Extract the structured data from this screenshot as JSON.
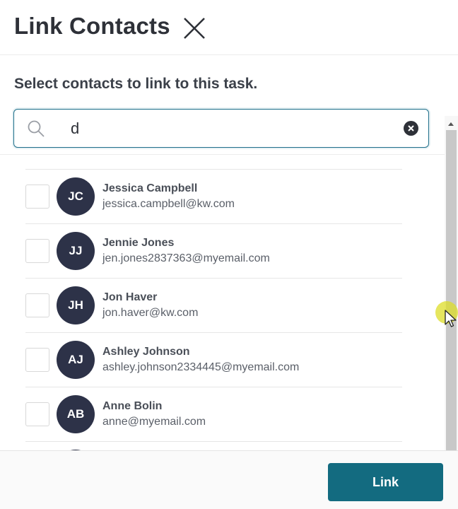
{
  "dialog": {
    "title": "Link Contacts",
    "instruction": "Select contacts to link to this task.",
    "search": {
      "value": "d",
      "placeholder": ""
    },
    "contacts": [
      {
        "initials": "JC",
        "name": "Jessica Campbell",
        "email": "jessica.campbell@kw.com",
        "checked": false
      },
      {
        "initials": "JJ",
        "name": "Jennie Jones",
        "email": "jen.jones2837363@myemail.com",
        "checked": false
      },
      {
        "initials": "JH",
        "name": "Jon Haver",
        "email": "jon.haver@kw.com",
        "checked": false
      },
      {
        "initials": "AJ",
        "name": "Ashley Johnson",
        "email": "ashley.johnson2334445@myemail.com",
        "checked": false
      },
      {
        "initials": "AB",
        "name": "Anne Bolin",
        "email": "anne@myemail.com",
        "checked": false
      }
    ],
    "link_button": "Link"
  },
  "colors": {
    "primary": "#136b80",
    "avatar": "#2d3248",
    "focus_border": "#1f6f8a"
  },
  "icons": [
    "close-icon",
    "search-icon",
    "clear-icon",
    "scroll-up-icon",
    "scroll-down-icon",
    "mouse-pointer-icon"
  ]
}
